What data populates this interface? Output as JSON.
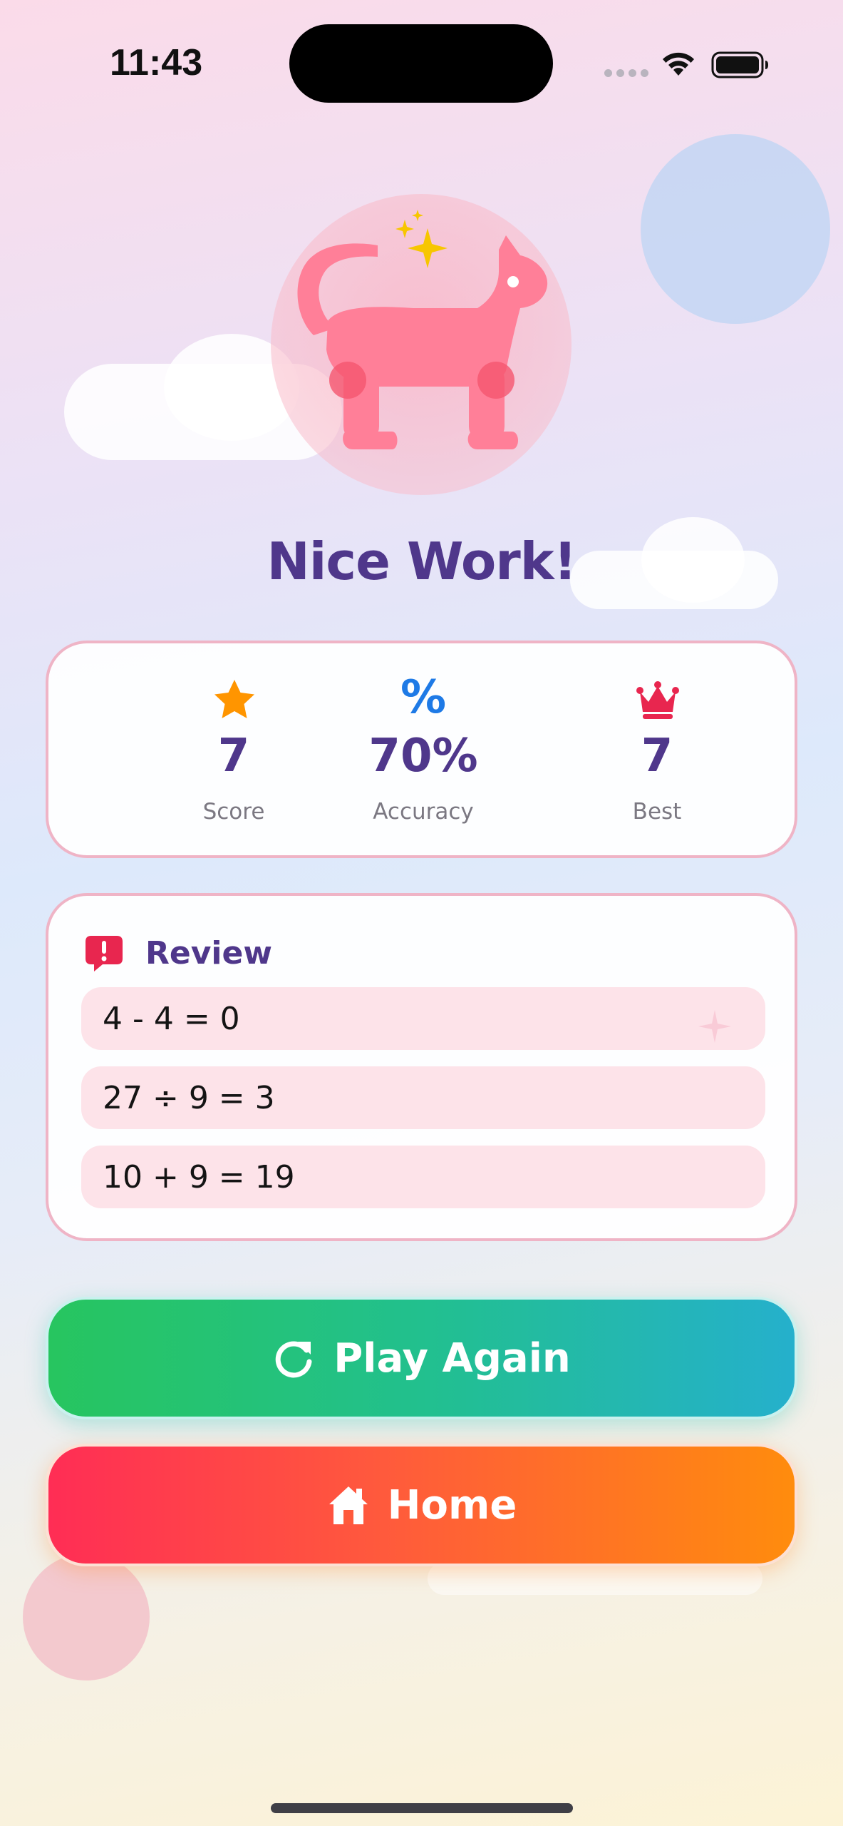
{
  "status_bar": {
    "time": "11:43"
  },
  "result": {
    "title": "Nice Work!"
  },
  "stats": {
    "score": {
      "value": "7",
      "label": "Score",
      "icon": "star-icon",
      "color": "#ff9500"
    },
    "accuracy": {
      "value": "70%",
      "label": "Accuracy",
      "icon_text": "%",
      "color": "#1e7ae6"
    },
    "best": {
      "value": "7",
      "label": "Best",
      "icon": "crown-icon",
      "color": "#e8264f"
    }
  },
  "review": {
    "title": "Review",
    "icon": "alert-bubble-icon",
    "items": [
      {
        "text": "4 - 4 = 0"
      },
      {
        "text": "27 ÷ 9 = 3"
      },
      {
        "text": "10 + 9 = 19"
      }
    ]
  },
  "buttons": {
    "play_again": {
      "label": "Play Again",
      "icon": "refresh-icon"
    },
    "home": {
      "label": "Home",
      "icon": "house-icon"
    }
  },
  "colors": {
    "title": "#4f378b",
    "card_border": "#efb4c6",
    "review_item_bg": "#fde3e9",
    "play_gradient_start": "#27c55f",
    "play_gradient_end": "#25b0cc",
    "home_gradient_start": "#ff2d55",
    "home_gradient_end": "#ff8c0d",
    "mascot": "#ff7f98"
  }
}
